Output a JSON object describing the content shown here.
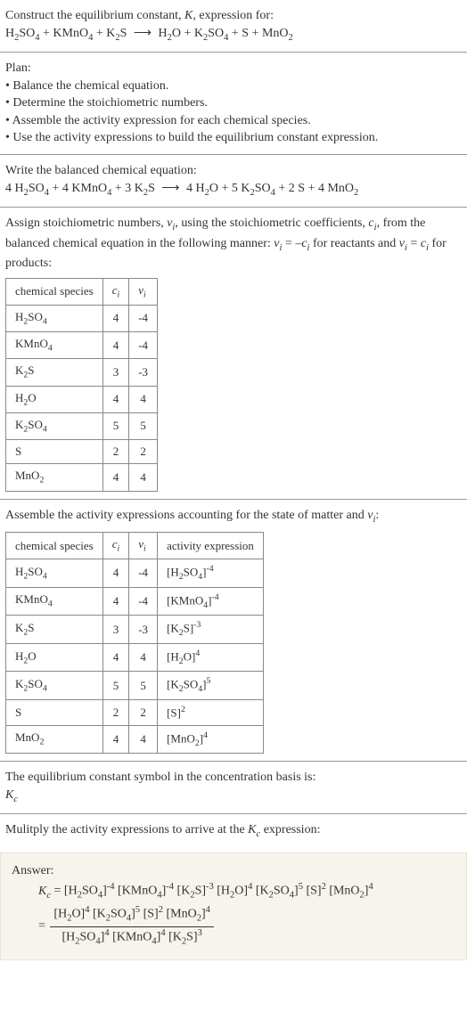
{
  "intro": {
    "construct_line": "Construct the equilibrium constant, K, expression for:",
    "equation_unbalanced": "H₂SO₄ + KMnO₄ + K₂S ⟶ H₂O + K₂SO₄ + S + MnO₂"
  },
  "plan": {
    "heading": "Plan:",
    "items": [
      "Balance the chemical equation.",
      "Determine the stoichiometric numbers.",
      "Assemble the activity expression for each chemical species.",
      "Use the activity expressions to build the equilibrium constant expression."
    ]
  },
  "balanced": {
    "heading": "Write the balanced chemical equation:",
    "equation": "4 H₂SO₄ + 4 KMnO₄ + 3 K₂S ⟶ 4 H₂O + 5 K₂SO₄ + 2 S + 4 MnO₂"
  },
  "stoich": {
    "heading_a": "Assign stoichiometric numbers, νᵢ, using the stoichiometric coefficients, cᵢ, from the balanced chemical equation in the following manner: νᵢ = –cᵢ for reactants and νᵢ = cᵢ for products:",
    "table_headers": [
      "chemical species",
      "cᵢ",
      "νᵢ"
    ],
    "rows": [
      {
        "species": "H₂SO₄",
        "c": "4",
        "nu": "-4"
      },
      {
        "species": "KMnO₄",
        "c": "4",
        "nu": "-4"
      },
      {
        "species": "K₂S",
        "c": "3",
        "nu": "-3"
      },
      {
        "species": "H₂O",
        "c": "4",
        "nu": "4"
      },
      {
        "species": "K₂SO₄",
        "c": "5",
        "nu": "5"
      },
      {
        "species": "S",
        "c": "2",
        "nu": "2"
      },
      {
        "species": "MnO₂",
        "c": "4",
        "nu": "4"
      }
    ]
  },
  "activity": {
    "heading": "Assemble the activity expressions accounting for the state of matter and νᵢ:",
    "table_headers": [
      "chemical species",
      "cᵢ",
      "νᵢ",
      "activity expression"
    ],
    "rows": [
      {
        "species": "H₂SO₄",
        "c": "4",
        "nu": "-4",
        "expr": "[H₂SO₄]⁻⁴"
      },
      {
        "species": "KMnO₄",
        "c": "4",
        "nu": "-4",
        "expr": "[KMnO₄]⁻⁴"
      },
      {
        "species": "K₂S",
        "c": "3",
        "nu": "-3",
        "expr": "[K₂S]⁻³"
      },
      {
        "species": "H₂O",
        "c": "4",
        "nu": "4",
        "expr": "[H₂O]⁴"
      },
      {
        "species": "K₂SO₄",
        "c": "5",
        "nu": "5",
        "expr": "[K₂SO₄]⁵"
      },
      {
        "species": "S",
        "c": "2",
        "nu": "2",
        "expr": "[S]²"
      },
      {
        "species": "MnO₂",
        "c": "4",
        "nu": "4",
        "expr": "[MnO₂]⁴"
      }
    ]
  },
  "symbol": {
    "heading": "The equilibrium constant symbol in the concentration basis is:",
    "value": "K𝒸"
  },
  "multiply": {
    "heading": "Mulitply the activity expressions to arrive at the K𝒸 expression:"
  },
  "answer": {
    "label": "Answer:",
    "line1": "K𝒸 = [H₂SO₄]⁻⁴ [KMnO₄]⁻⁴ [K₂S]⁻³ [H₂O]⁴ [K₂SO₄]⁵ [S]² [MnO₂]⁴",
    "frac_num": "[H₂O]⁴ [K₂SO₄]⁵ [S]² [MnO₂]⁴",
    "frac_den": "[H₂SO₄]⁴ [KMnO₄]⁴ [K₂S]³",
    "equals": "="
  },
  "chart_data": {
    "type": "table",
    "tables": [
      {
        "title": "Stoichiometric numbers",
        "columns": [
          "chemical species",
          "c_i",
          "nu_i"
        ],
        "rows": [
          [
            "H2SO4",
            4,
            -4
          ],
          [
            "KMnO4",
            4,
            -4
          ],
          [
            "K2S",
            3,
            -3
          ],
          [
            "H2O",
            4,
            4
          ],
          [
            "K2SO4",
            5,
            5
          ],
          [
            "S",
            2,
            2
          ],
          [
            "MnO2",
            4,
            4
          ]
        ]
      },
      {
        "title": "Activity expressions",
        "columns": [
          "chemical species",
          "c_i",
          "nu_i",
          "activity expression"
        ],
        "rows": [
          [
            "H2SO4",
            4,
            -4,
            "[H2SO4]^-4"
          ],
          [
            "KMnO4",
            4,
            -4,
            "[KMnO4]^-4"
          ],
          [
            "K2S",
            3,
            -3,
            "[K2S]^-3"
          ],
          [
            "H2O",
            4,
            4,
            "[H2O]^4"
          ],
          [
            "K2SO4",
            5,
            5,
            "[K2SO4]^5"
          ],
          [
            "S",
            2,
            2,
            "[S]^2"
          ],
          [
            "MnO2",
            4,
            4,
            "[MnO2]^4"
          ]
        ]
      }
    ]
  }
}
